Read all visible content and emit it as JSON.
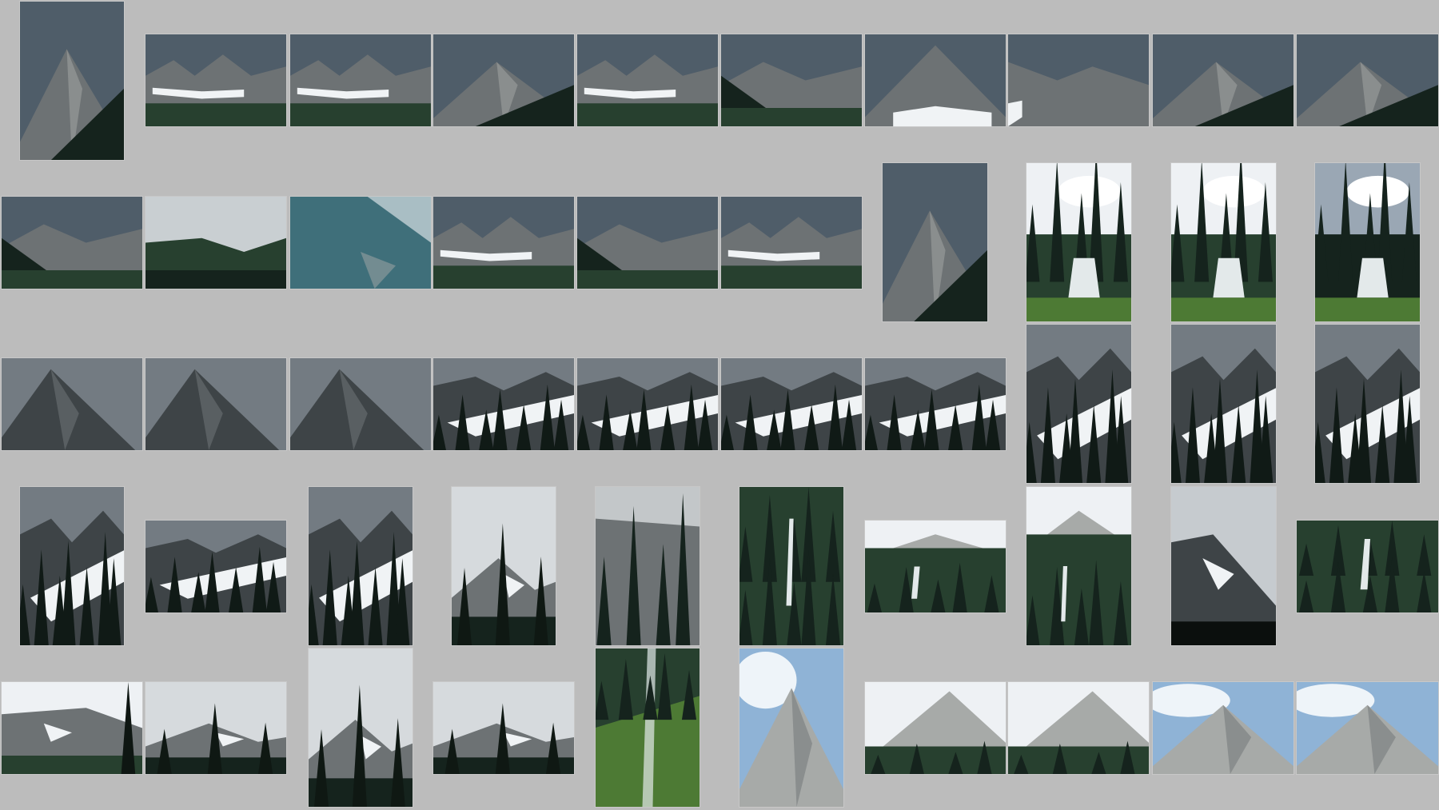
{
  "app": {
    "title": "",
    "background": "#bcbcbc"
  },
  "palette": {
    "sky_overcast": "#4f5d69",
    "sky_grey": "#737b82",
    "sky_blue": "#8fb3d6",
    "cloud_white": "#eef1f4",
    "rock_light": "#a7aaa8",
    "rock_mid": "#6d7274",
    "rock_dark": "#3e4447",
    "snow": "#f0f3f5",
    "forest_dark": "#15231d",
    "forest_mid": "#27402f",
    "meadow_green": "#4d7a34",
    "water_white": "#e3e9ea",
    "teal_slope": "#3f6f7a"
  },
  "thumbnails": [
    {
      "scene": "peak-overcast"
    },
    {
      "scene": "ridge-snowband"
    },
    {
      "scene": "ridge-snowband"
    },
    {
      "scene": "peak-overcast"
    },
    {
      "scene": "ridge-snowband"
    },
    {
      "scene": "ridge-forest"
    },
    {
      "scene": "peak-snowbase"
    },
    {
      "scene": "ridge-overcast"
    },
    {
      "scene": "peak-overcast"
    },
    {
      "scene": "peak-overcast"
    },
    {
      "scene": "ridge-forest"
    },
    {
      "scene": "forest-hills"
    },
    {
      "scene": "teal-slope"
    },
    {
      "scene": "ridge-snowband"
    },
    {
      "scene": "ridge-forest"
    },
    {
      "scene": "ridge-snowband"
    },
    {
      "scene": "peak-overcast"
    },
    {
      "scene": "forest-creek-clouds"
    },
    {
      "scene": "forest-creek-clouds"
    },
    {
      "scene": "forest-creek-dark"
    },
    {
      "scene": "peak-dark"
    },
    {
      "scene": "peak-dark"
    },
    {
      "scene": "peak-dark"
    },
    {
      "scene": "glacier-trees"
    },
    {
      "scene": "glacier-trees"
    },
    {
      "scene": "glacier-trees"
    },
    {
      "scene": "glacier-trees"
    },
    {
      "scene": "glacier-trees"
    },
    {
      "scene": "glacier-trees"
    },
    {
      "scene": "glacier-trees"
    },
    {
      "scene": "glacier-trees"
    },
    {
      "scene": "glacier-trees"
    },
    {
      "scene": "glacier-trees"
    },
    {
      "scene": "peak-grey-clouds"
    },
    {
      "scene": "rock-slope-trees"
    },
    {
      "scene": "forest-waterfall"
    },
    {
      "scene": "forest-waterfall-peak"
    },
    {
      "scene": "forest-waterfall-peak"
    },
    {
      "scene": "ridge-dark-clouds"
    },
    {
      "scene": "forest-waterfall"
    },
    {
      "scene": "peak-snow-tree"
    },
    {
      "scene": "peak-grey-clouds"
    },
    {
      "scene": "peak-grey-clouds"
    },
    {
      "scene": "peak-grey-clouds"
    },
    {
      "scene": "valley-green-creek"
    },
    {
      "scene": "peak-bluesky"
    },
    {
      "scene": "peak-bluesky-forest"
    },
    {
      "scene": "peak-bluesky-forest"
    },
    {
      "scene": "peak-bluesky"
    },
    {
      "scene": "peak-bluesky"
    },
    {
      "scene": "forest-snowpatch"
    },
    {
      "scene": "valley-green-creek"
    }
  ]
}
